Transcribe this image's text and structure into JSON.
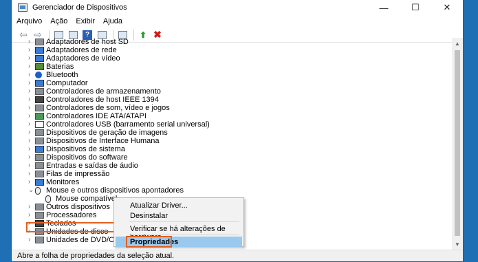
{
  "window": {
    "title": "Gerenciador de Dispositivos",
    "min": "—",
    "max": "☐",
    "close": "✕"
  },
  "menu": [
    "Arquivo",
    "Ação",
    "Exibir",
    "Ajuda"
  ],
  "tree": {
    "items": [
      {
        "label": "Adaptadores de host SD",
        "icon": "sd-card-icon"
      },
      {
        "label": "Adaptadores de rede",
        "icon": "network-adapter-icon"
      },
      {
        "label": "Adaptadores de vídeo",
        "icon": "display-adapter-icon"
      },
      {
        "label": "Baterias",
        "icon": "battery-icon"
      },
      {
        "label": "Bluetooth",
        "icon": "bluetooth-icon"
      },
      {
        "label": "Computador",
        "icon": "computer-icon"
      },
      {
        "label": "Controladores de armazenamento",
        "icon": "storage-controller-icon"
      },
      {
        "label": "Controladores de host IEEE 1394",
        "icon": "ieee1394-icon"
      },
      {
        "label": "Controladores de som, vídeo e jogos",
        "icon": "sound-icon"
      },
      {
        "label": "Controladores IDE ATA/ATAPI",
        "icon": "ide-icon"
      },
      {
        "label": "Controladores USB (barramento serial universal)",
        "icon": "usb-icon"
      },
      {
        "label": "Dispositivos de geração de imagens",
        "icon": "camera-icon"
      },
      {
        "label": "Dispositivos de Interface Humana",
        "icon": "hid-icon"
      },
      {
        "label": "Dispositivos de sistema",
        "icon": "system-device-icon"
      },
      {
        "label": "Dispositivos do software",
        "icon": "software-device-icon"
      },
      {
        "label": "Entradas e saídas de áudio",
        "icon": "audio-io-icon"
      },
      {
        "label": "Filas de impressão",
        "icon": "printer-icon"
      },
      {
        "label": "Monitores",
        "icon": "monitor-icon"
      },
      {
        "label": "Mouse e outros dispositivos apontadores",
        "icon": "mouse-icon"
      },
      {
        "label": "Mouse compatível",
        "icon": "mouse-icon"
      },
      {
        "label": "Outros dispositivos",
        "icon": "other-device-icon"
      },
      {
        "label": "Processadores",
        "icon": "processor-icon"
      },
      {
        "label": "Teclados",
        "icon": "keyboard-icon"
      },
      {
        "label": "Unidades de disco",
        "icon": "disk-drive-icon"
      },
      {
        "label": "Unidades de DVD/CD-ROM",
        "icon": "dvd-icon"
      }
    ]
  },
  "context_menu": {
    "items": [
      "Atualizar Driver...",
      "Desinstalar",
      "Verificar se há alterações de hardware",
      "Propriedades"
    ]
  },
  "status": "Abre a folha de propriedades da seleção atual.",
  "colors": {
    "highlight": "#e06020",
    "menu_selected": "#99c9ef",
    "desktop": "#1e6fb4"
  }
}
